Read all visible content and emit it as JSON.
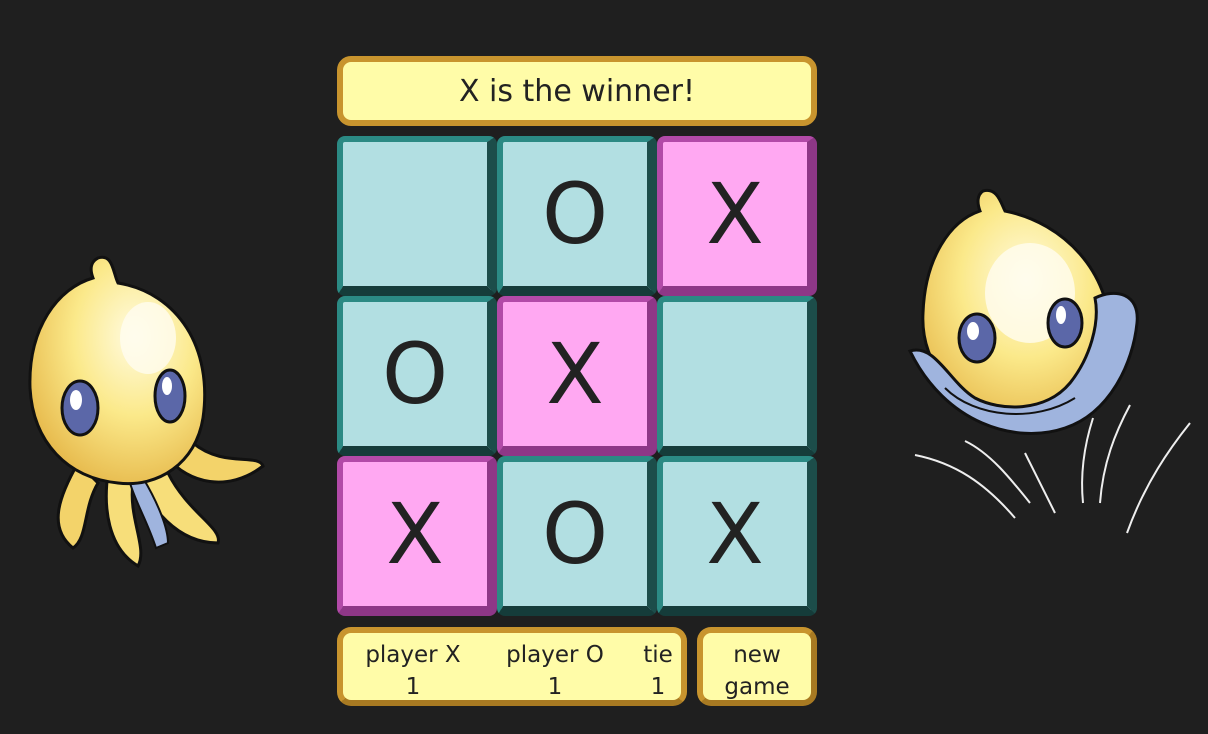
{
  "status": {
    "message": "X is the winner!"
  },
  "board": {
    "cells": [
      {
        "mark": "",
        "highlight": false
      },
      {
        "mark": "O",
        "highlight": false
      },
      {
        "mark": "X",
        "highlight": true
      },
      {
        "mark": "O",
        "highlight": false
      },
      {
        "mark": "X",
        "highlight": true
      },
      {
        "mark": "",
        "highlight": false
      },
      {
        "mark": "X",
        "highlight": true
      },
      {
        "mark": "O",
        "highlight": false
      },
      {
        "mark": "X",
        "highlight": false
      }
    ]
  },
  "score": {
    "player_x_label": "player X",
    "player_x_value": "1",
    "player_o_label": "player O",
    "player_o_value": "1",
    "tie_label": "tie",
    "tie_value": "1"
  },
  "controls": {
    "new_game_label": "new\ngame"
  },
  "colors": {
    "background": "#1f1f1f",
    "panel": "#fffca8",
    "panel_border": "#c8942e",
    "cell": "#b2dfe2",
    "cell_border": "#2b8a84",
    "win_cell": "#ffa8f2",
    "win_border": "#b24aa8"
  },
  "icons": {
    "left_mascot": "yellow-octopus-icon",
    "right_mascot": "yellow-octopus-hiding-icon"
  }
}
